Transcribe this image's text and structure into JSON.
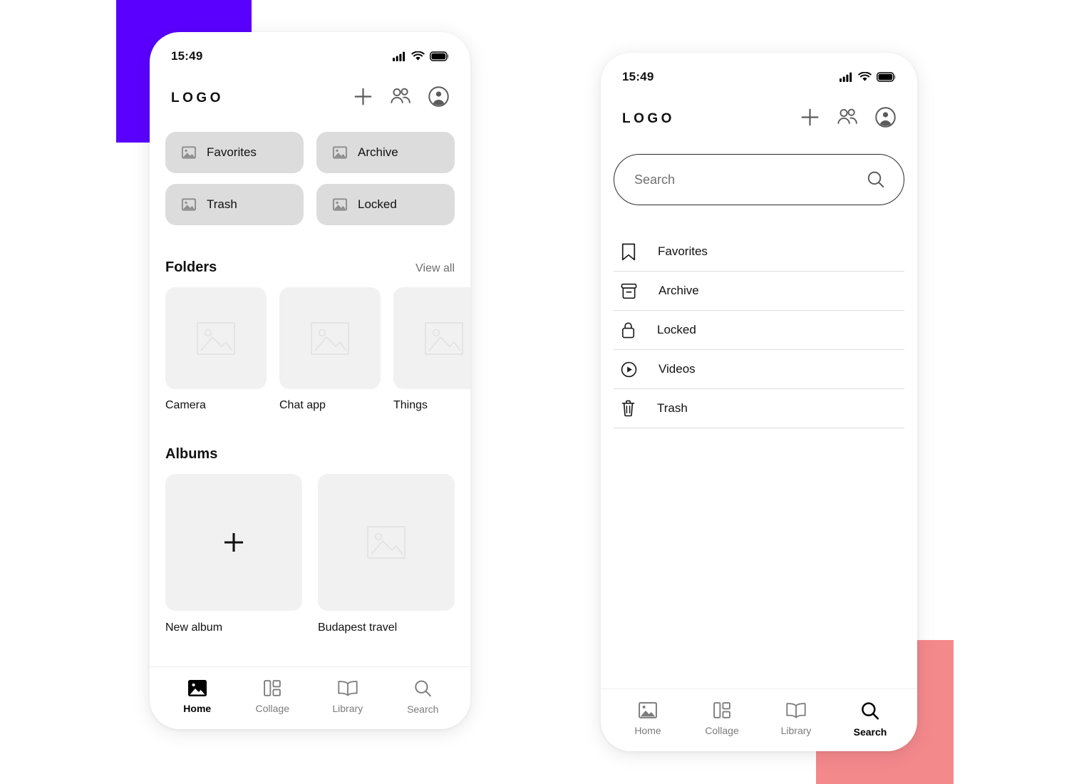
{
  "decor": {
    "purple_block_color": "#5A00FF",
    "pink_block_color": "#F4898C"
  },
  "phone_left": {
    "status": {
      "time": "15:49",
      "signal_icon": "signal-bars-icon",
      "wifi_icon": "wifi-icon",
      "battery_icon": "battery-full-icon"
    },
    "appbar": {
      "logo": "LOGO",
      "actions": [
        {
          "name": "add-button",
          "icon": "plus-icon"
        },
        {
          "name": "people-button",
          "icon": "people-group-icon"
        },
        {
          "name": "account-button",
          "icon": "account-circle-icon"
        }
      ]
    },
    "tiles": [
      {
        "label": "Favorites",
        "icon": "image-icon"
      },
      {
        "label": "Archive",
        "icon": "image-icon"
      },
      {
        "label": "Trash",
        "icon": "image-icon"
      },
      {
        "label": "Locked",
        "icon": "image-icon"
      }
    ],
    "folders_section": {
      "title": "Folders",
      "view_all": "View all",
      "items": [
        {
          "name": "Camera",
          "icon": "image-placeholder-icon"
        },
        {
          "name": "Chat app",
          "icon": "image-placeholder-icon"
        },
        {
          "name": "Things",
          "icon": "image-placeholder-icon"
        }
      ]
    },
    "albums_section": {
      "title": "Albums",
      "items": [
        {
          "name": "New album",
          "icon": "plus-icon"
        },
        {
          "name": "Budapest travel",
          "icon": "image-placeholder-icon"
        }
      ]
    },
    "tabs": [
      {
        "label": "Home",
        "icon": "image-filled-icon",
        "active": true
      },
      {
        "label": "Collage",
        "icon": "collage-grid-icon",
        "active": false
      },
      {
        "label": "Library",
        "icon": "open-book-icon",
        "active": false
      },
      {
        "label": "Search",
        "icon": "search-icon",
        "active": false
      }
    ]
  },
  "phone_right": {
    "status": {
      "time": "15:49",
      "signal_icon": "signal-bars-icon",
      "wifi_icon": "wifi-icon",
      "battery_icon": "battery-full-icon"
    },
    "appbar": {
      "logo": "LOGO",
      "actions": [
        {
          "name": "add-button",
          "icon": "plus-icon"
        },
        {
          "name": "people-button",
          "icon": "people-group-icon"
        },
        {
          "name": "account-button",
          "icon": "account-circle-icon"
        }
      ]
    },
    "search": {
      "value": "",
      "placeholder": "Search",
      "icon": "search-icon"
    },
    "list": [
      {
        "label": "Favorites",
        "icon": "bookmark-icon"
      },
      {
        "label": "Archive",
        "icon": "archive-box-icon"
      },
      {
        "label": "Locked",
        "icon": "lock-icon"
      },
      {
        "label": "Videos",
        "icon": "play-circle-icon"
      },
      {
        "label": "Trash",
        "icon": "trash-can-icon"
      }
    ],
    "tabs": [
      {
        "label": "Home",
        "icon": "image-filled-icon",
        "active": false
      },
      {
        "label": "Collage",
        "icon": "collage-grid-icon",
        "active": false
      },
      {
        "label": "Library",
        "icon": "open-book-icon",
        "active": false
      },
      {
        "label": "Search",
        "icon": "search-icon",
        "active": true
      }
    ]
  }
}
